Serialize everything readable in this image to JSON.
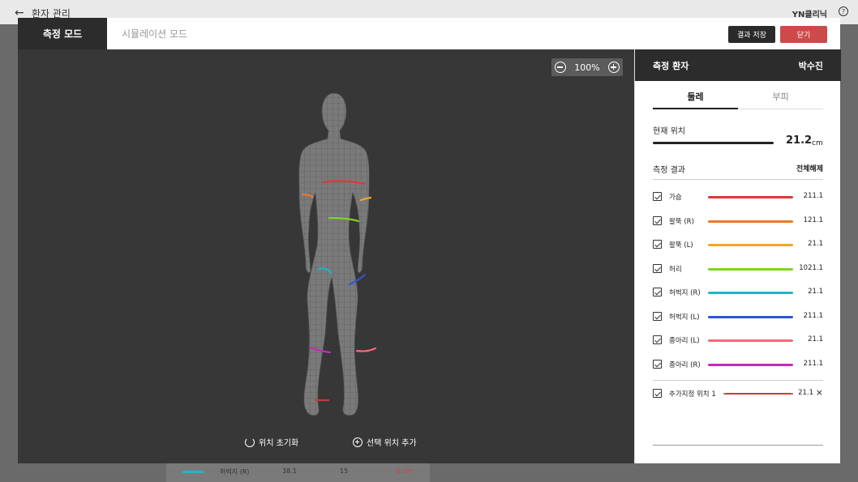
{
  "background": {
    "back_icon": "arrow-left-icon",
    "title": "환자 관리",
    "clinic": "YN클리닉",
    "help_icon": "help-circle-icon",
    "strip_label": "허벅지 (R)",
    "strip_v1": "38.1",
    "strip_v2": "15",
    "strip_v3": "-8 cm"
  },
  "tabs": {
    "measure": "측정 모드",
    "simulation": "시뮬레이션 모드"
  },
  "buttons": {
    "save": "결과 저장",
    "close": "닫기"
  },
  "viewer": {
    "zoom": "100%",
    "reset": "위치 초기화",
    "add": "선택 위치 추가"
  },
  "panel": {
    "patient_label": "측정 환자",
    "patient_name": "박수진",
    "tabs": [
      "둘레",
      "부피"
    ],
    "current_label": "현재 위치",
    "current_value": "21.2",
    "current_unit": "cm",
    "results_label": "측정 결과",
    "clear_all": "전체해제",
    "items": [
      {
        "label": "가슴",
        "value": "211.1",
        "color": "#d93a3a"
      },
      {
        "label": "팔뚝 (R)",
        "value": "121.1",
        "color": "#f07828"
      },
      {
        "label": "팔뚝 (L)",
        "value": "21.1",
        "color": "#f5a623"
      },
      {
        "label": "허리",
        "value": "1021.1",
        "color": "#7ed321"
      },
      {
        "label": "허벅지 (R)",
        "value": "21.1",
        "color": "#1fb5c9"
      },
      {
        "label": "허벅지 (L)",
        "value": "211.1",
        "color": "#2f55d4"
      },
      {
        "label": "종아리 (L)",
        "value": "21.1",
        "color": "#f06b7a"
      },
      {
        "label": "종아리 (R)",
        "value": "211.1",
        "color": "#c42ab8"
      }
    ],
    "extra": {
      "label": "추가지정 위치 1",
      "value": "21.1",
      "color": "#cc3a3a"
    }
  }
}
